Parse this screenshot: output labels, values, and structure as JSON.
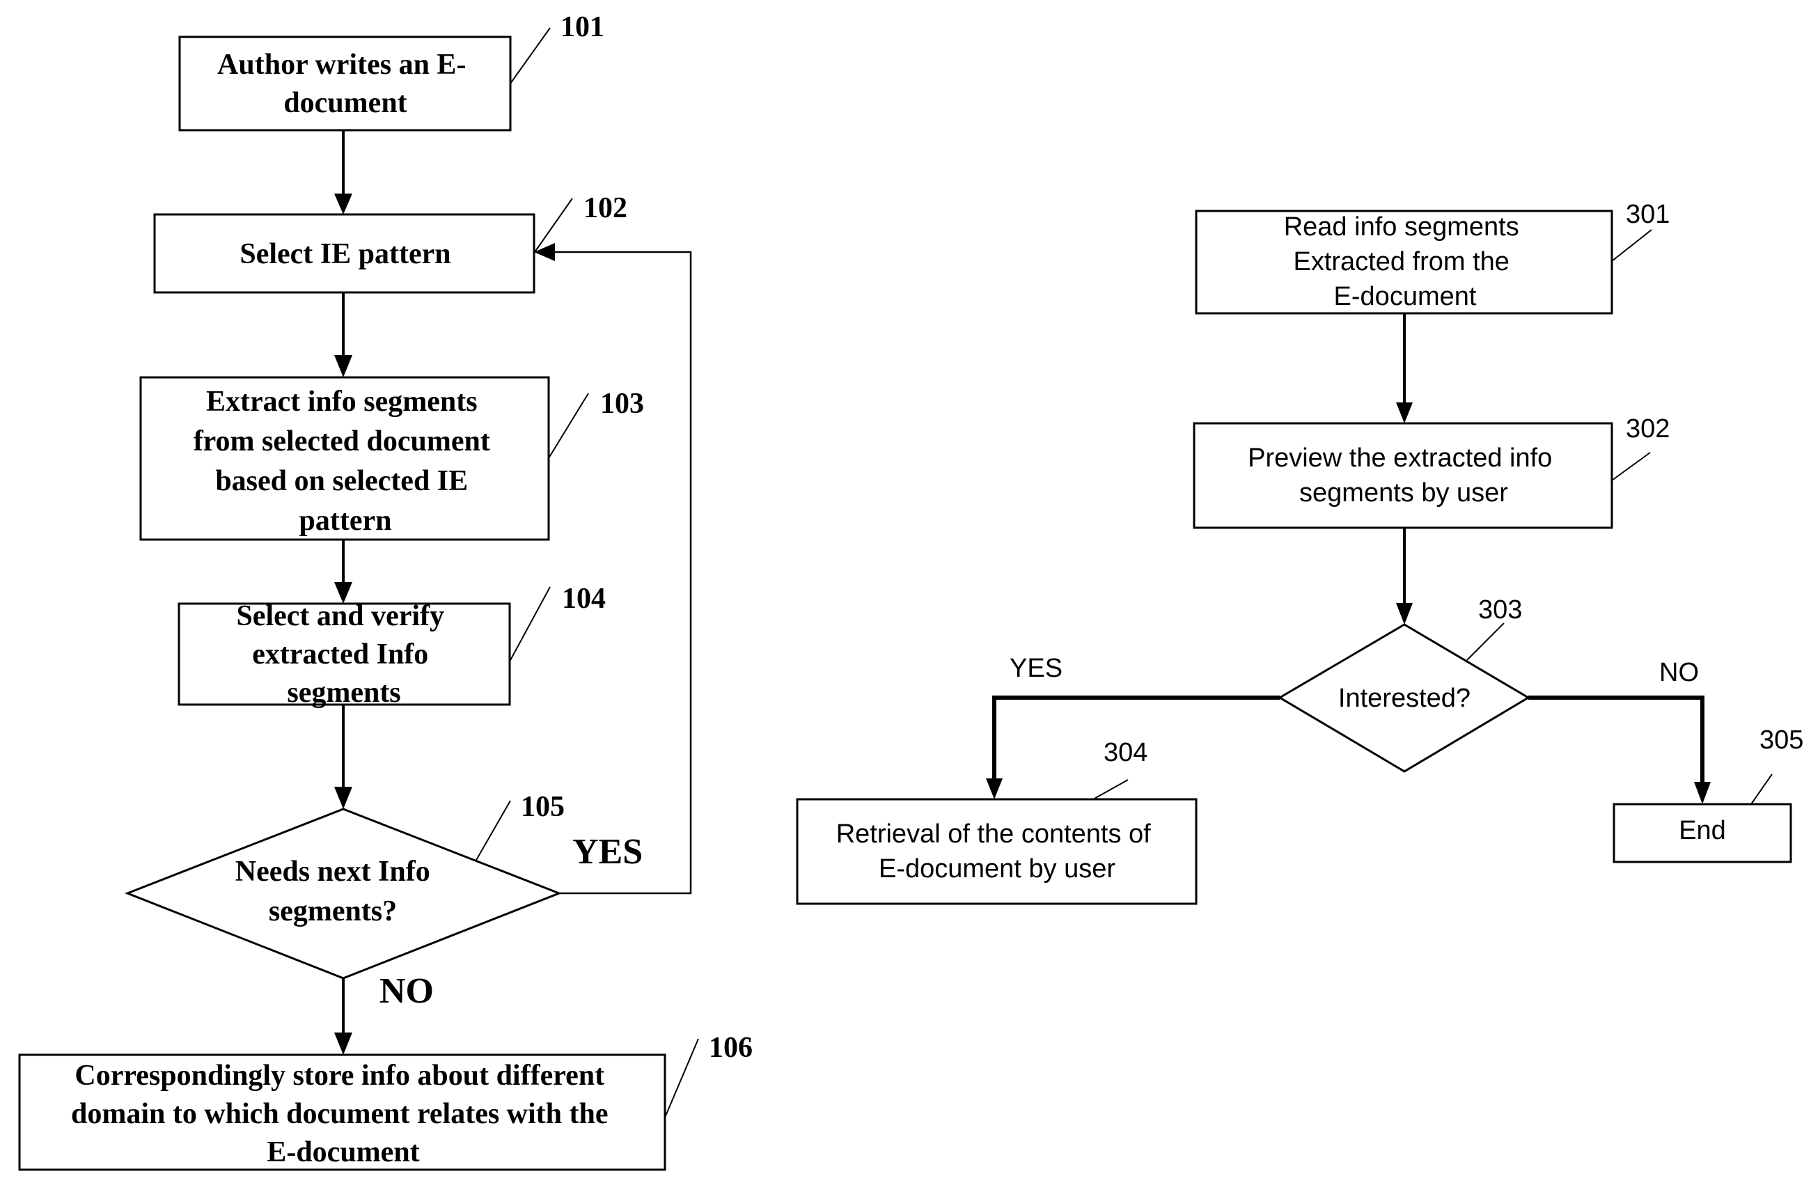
{
  "left_flow": {
    "steps": [
      {
        "ref": "101",
        "lines": [
          "Author writes an E-",
          "document"
        ]
      },
      {
        "ref": "102",
        "lines": [
          "Select IE pattern"
        ]
      },
      {
        "ref": "103",
        "lines": [
          "Extract info segments",
          "from selected document",
          "based on selected IE",
          "pattern"
        ]
      },
      {
        "ref": "104",
        "lines": [
          "Select and verify",
          "extracted Info",
          "segments"
        ]
      },
      {
        "ref": "105",
        "lines": [
          "Needs next Info",
          "segments?"
        ]
      },
      {
        "ref": "106",
        "lines": [
          "Correspondingly store info about different",
          "domain to which document relates with the",
          "E-document"
        ]
      }
    ],
    "yes_label": "YES",
    "no_label": "NO"
  },
  "right_flow": {
    "steps": [
      {
        "ref": "301",
        "lines": [
          "Read info segments",
          "Extracted from the",
          "E-document"
        ]
      },
      {
        "ref": "302",
        "lines": [
          "Preview the extracted info",
          "segments by user"
        ]
      },
      {
        "ref": "303",
        "lines": [
          "Interested?"
        ]
      },
      {
        "ref": "304",
        "lines": [
          "Retrieval of the contents of",
          "E-document by user"
        ]
      },
      {
        "ref": "305",
        "lines": [
          "End"
        ]
      }
    ],
    "yes_label": "YES",
    "no_label": "NO"
  }
}
